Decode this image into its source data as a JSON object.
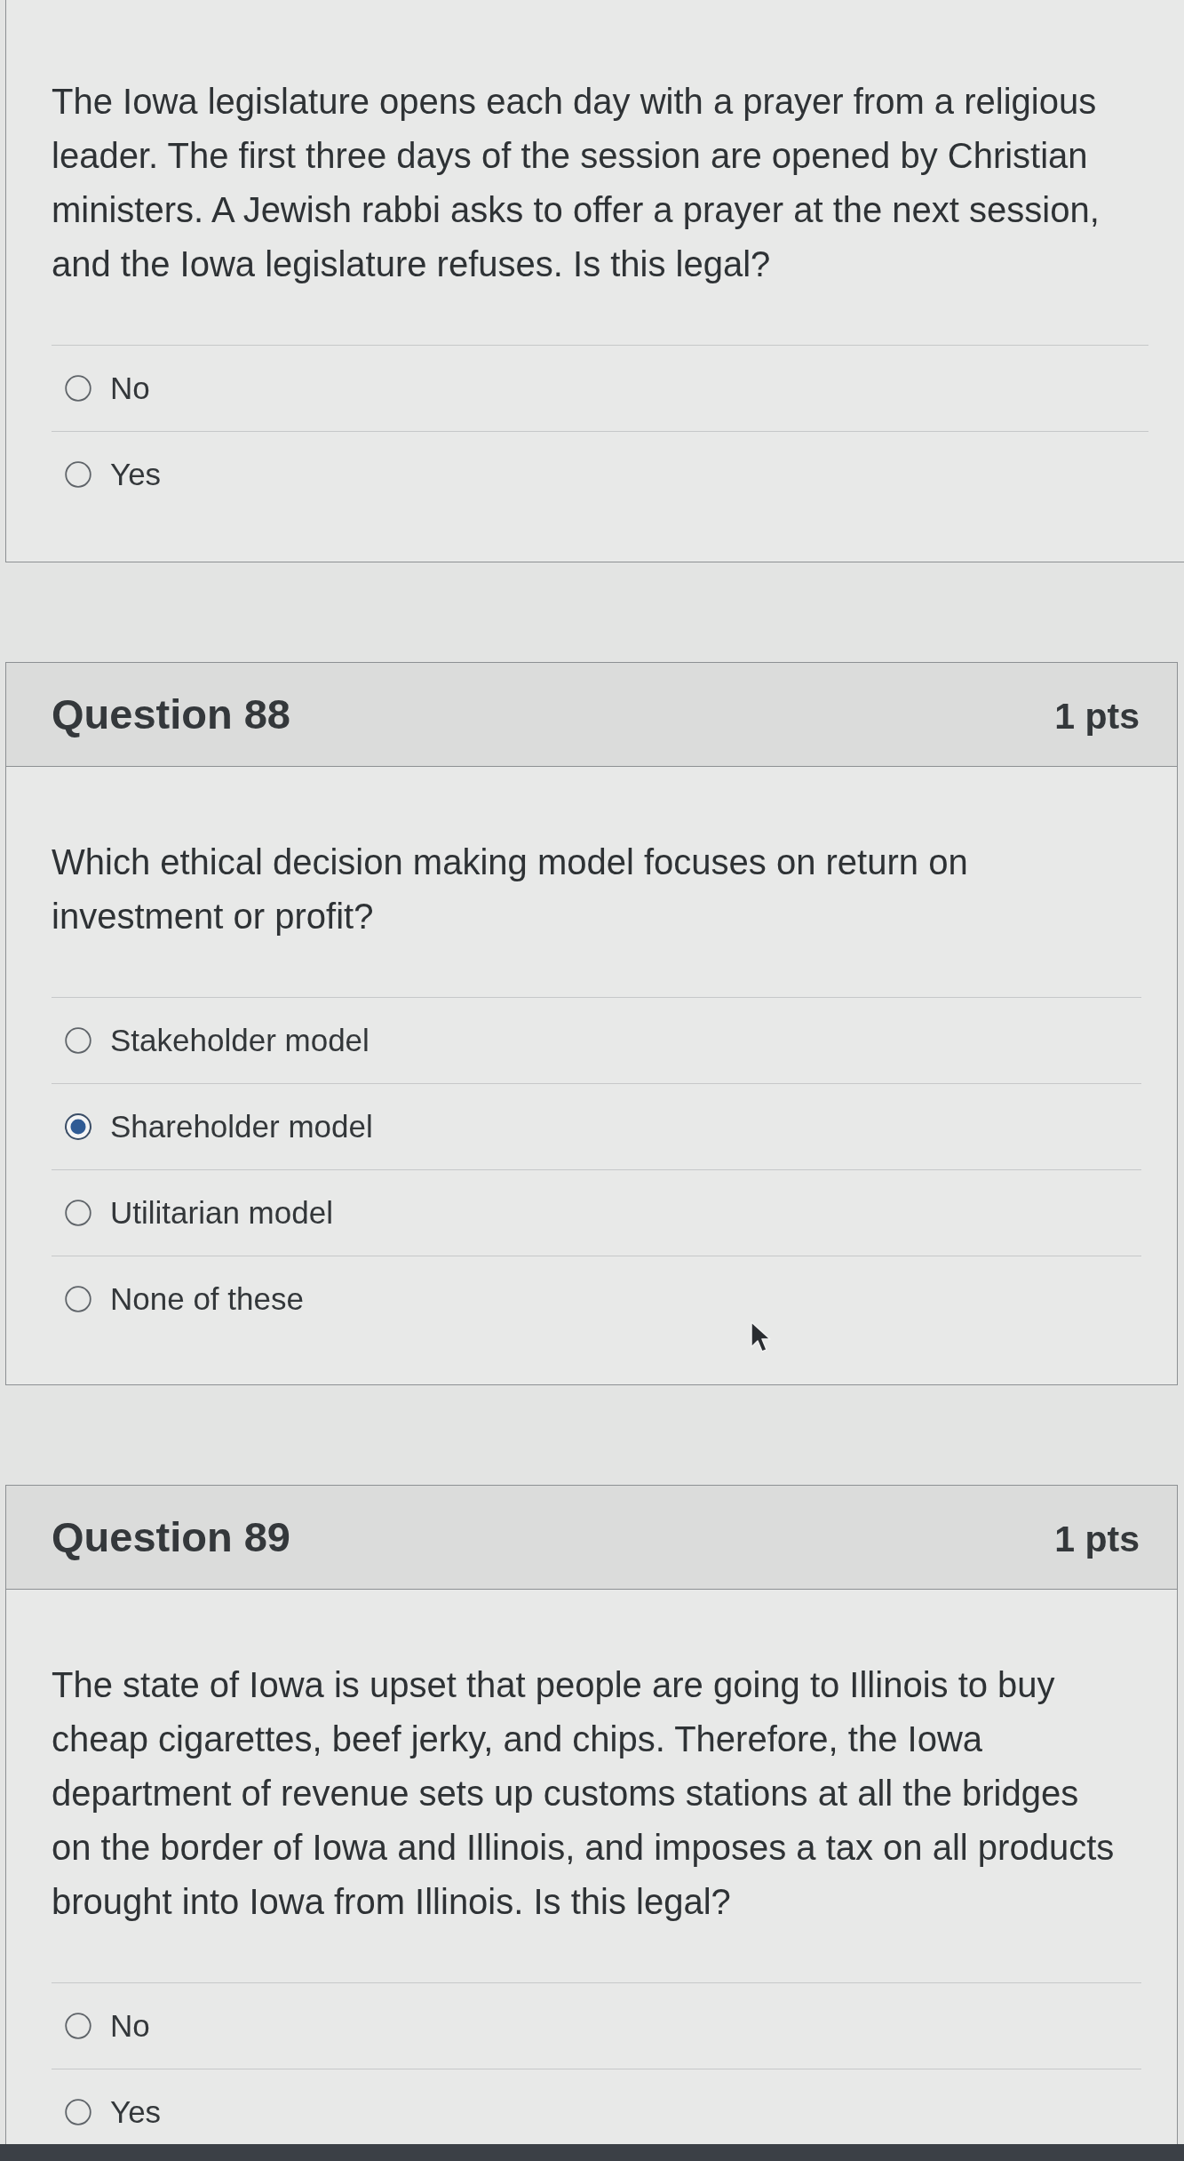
{
  "questions": [
    {
      "text": "The Iowa legislature opens each day with a prayer from a religious\nleader. The first three days of the session are opened by Christian\nministers. A Jewish rabbi asks to offer a prayer at the next session,\nand the Iowa legislature refuses. Is this legal?",
      "options": [
        {
          "label": "No",
          "selected": false
        },
        {
          "label": "Yes",
          "selected": false
        }
      ]
    },
    {
      "title": "Question 88",
      "points": "1 pts",
      "text": "Which ethical decision making model focuses on return on\ninvestment or profit?",
      "options": [
        {
          "label": "Stakeholder model",
          "selected": false
        },
        {
          "label": "Shareholder model",
          "selected": true
        },
        {
          "label": "Utilitarian model",
          "selected": false
        },
        {
          "label": "None of these",
          "selected": false
        }
      ]
    },
    {
      "title": "Question 89",
      "points": "1 pts",
      "text": "The state of Iowa is upset that people are going to Illinois to buy\ncheap cigarettes, beef jerky, and chips. Therefore, the Iowa\ndepartment of revenue sets up customs stations at all the bridges\non the border of Iowa and Illinois, and imposes a tax on all products\nbrought into Iowa from Illinois. Is this legal?",
      "options": [
        {
          "label": "No",
          "selected": false
        },
        {
          "label": "Yes",
          "selected": false
        }
      ]
    }
  ]
}
